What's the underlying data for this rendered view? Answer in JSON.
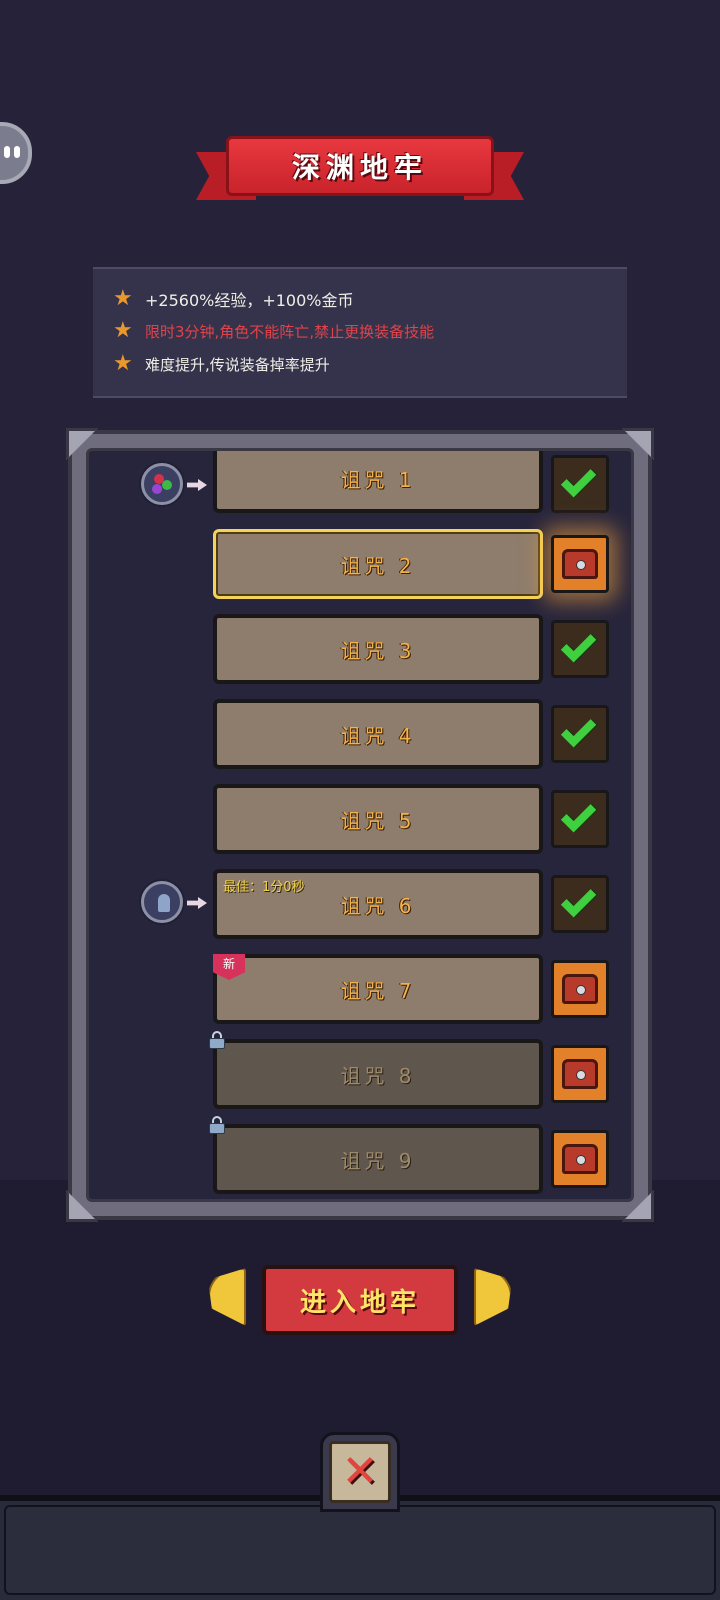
{
  "title": "深渊地牢",
  "info": {
    "line1": "+2560%经验，+100%金币",
    "line2": "限时3分钟,角色不能阵亡,禁止更换装备技能",
    "line3": "难度提升,传说装备掉率提升"
  },
  "curses": [
    {
      "label": "诅咒 1",
      "status": "completed",
      "reward": "check"
    },
    {
      "label": "诅咒 2",
      "status": "selected",
      "reward": "chest"
    },
    {
      "label": "诅咒 3",
      "status": "completed",
      "reward": "check"
    },
    {
      "label": "诅咒 4",
      "status": "completed",
      "reward": "check"
    },
    {
      "label": "诅咒 5",
      "status": "completed",
      "reward": "check"
    },
    {
      "label": "诅咒 6",
      "status": "completed",
      "reward": "check",
      "best": "最佳：1分0秒"
    },
    {
      "label": "诅咒 7",
      "status": "new",
      "reward": "chest",
      "tag": "新"
    },
    {
      "label": "诅咒 8",
      "status": "locked",
      "reward": "chest"
    },
    {
      "label": "诅咒 9",
      "status": "locked",
      "reward": "chest"
    }
  ],
  "enter_button": "进入地牢",
  "close_icon": "close-x-icon",
  "colors": {
    "accent_red": "#d23a3f",
    "gold": "#f3d35b",
    "check_green": "#3fcf3f",
    "chest_orange": "#e3802a"
  }
}
